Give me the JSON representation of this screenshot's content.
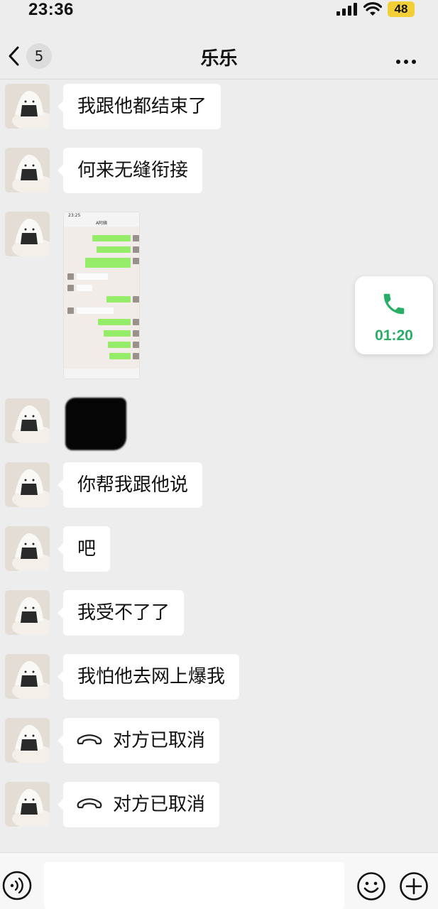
{
  "status_bar": {
    "time": "23:36",
    "battery": "48"
  },
  "nav": {
    "unread_count": "5",
    "title": "乐乐"
  },
  "messages": [
    {
      "type": "text",
      "text": "我跟他都结束了"
    },
    {
      "type": "text",
      "text": "何来无缝衔接"
    },
    {
      "type": "image",
      "description": "chat-screenshot"
    },
    {
      "type": "image",
      "description": "censored-image"
    },
    {
      "type": "text",
      "text": "你帮我跟他说"
    },
    {
      "type": "text",
      "text": "吧"
    },
    {
      "type": "text",
      "text": "我受不了了"
    },
    {
      "type": "text",
      "text": "我怕他去网上爆我"
    },
    {
      "type": "call",
      "text": "对方已取消"
    },
    {
      "type": "call",
      "text": "对方已取消"
    }
  ],
  "screenshot_preview": {
    "time": "23:25",
    "title": "A阿姨"
  },
  "call_widget": {
    "duration": "01:20"
  },
  "colors": {
    "background": "#ededed",
    "call_green": "#2aae67",
    "bubble": "#ffffff",
    "battery": "#f2cf36"
  },
  "icons": [
    "back-chevron-icon",
    "more-icon",
    "phone-icon",
    "hangup-icon",
    "voice-icon",
    "emoji-icon",
    "plus-icon"
  ]
}
